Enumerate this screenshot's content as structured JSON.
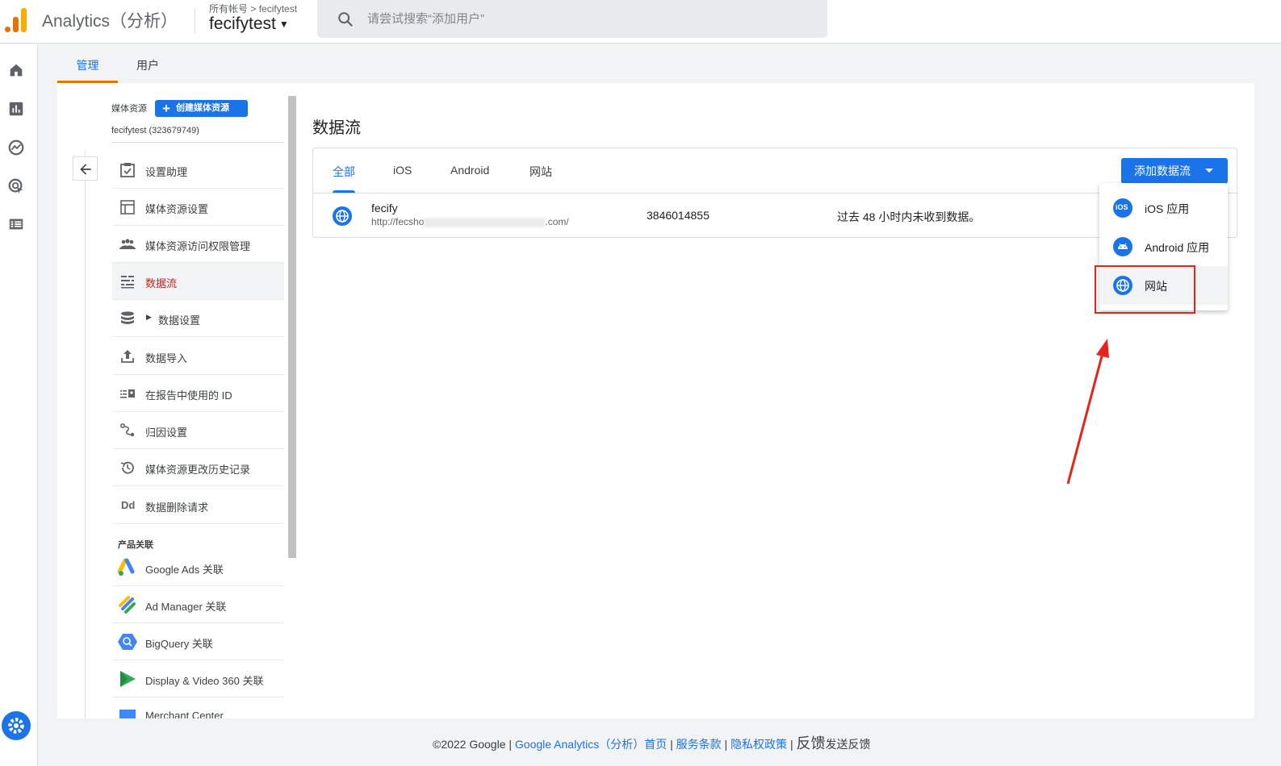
{
  "header": {
    "app_title": "Analytics（分析）",
    "breadcrumb_root": "所有帐号",
    "breadcrumb_sep": ">",
    "breadcrumb_account": "fecifytest",
    "account_name": "fecifytest",
    "search_placeholder": "请尝试搜索“添加用户”"
  },
  "rail": {
    "icons": [
      "home-icon",
      "reports-icon",
      "explore-icon",
      "advertising-icon",
      "configure-icon"
    ],
    "settings_icon": "gear-icon"
  },
  "admin_tabs": [
    {
      "label": "管理",
      "active": true
    },
    {
      "label": "用户",
      "active": false
    }
  ],
  "property": {
    "header_label": "媒体资源",
    "create_button": "创建媒体资源",
    "property_id": "fecifytest (323679749)",
    "nav_items": [
      {
        "label": "设置助理",
        "icon": "checklist-icon"
      },
      {
        "label": "媒体资源设置",
        "icon": "property-settings-icon"
      },
      {
        "label": "媒体资源访问权限管理",
        "icon": "people-icon"
      },
      {
        "label": "数据流",
        "icon": "data-streams-icon",
        "active": true
      },
      {
        "label": "数据设置",
        "icon": "database-icon",
        "expandable": true
      },
      {
        "label": "数据导入",
        "icon": "upload-icon"
      },
      {
        "label": "在报告中使用的 ID",
        "icon": "reporting-id-icon"
      },
      {
        "label": "归因设置",
        "icon": "attribution-icon"
      },
      {
        "label": "媒体资源更改历史记录",
        "icon": "history-icon"
      },
      {
        "label": "数据删除请求",
        "icon": "data-deletion-icon",
        "icon_text": "Dd"
      }
    ],
    "product_links_label": "产品关联",
    "product_links": [
      {
        "label": "Google Ads 关联",
        "icon": "google-ads-icon"
      },
      {
        "label": "Ad Manager 关联",
        "icon": "ad-manager-icon"
      },
      {
        "label": "BigQuery 关联",
        "icon": "bigquery-icon"
      },
      {
        "label": "Display & Video 360 关联",
        "icon": "dv360-icon"
      },
      {
        "label": "Merchant Center",
        "icon": "merchant-center-icon"
      }
    ]
  },
  "streams": {
    "title": "数据流",
    "tabs": [
      {
        "label": "全部",
        "active": true
      },
      {
        "label": "iOS",
        "active": false
      },
      {
        "label": "Android",
        "active": false
      },
      {
        "label": "网站",
        "active": false
      }
    ],
    "add_button": "添加数据流",
    "rows": [
      {
        "name": "fecify",
        "url_start": "http://fecsho",
        "url_end": ".com/",
        "stream_id": "3846014855",
        "status": "过去 48 小时内未收到数据。",
        "icon": "globe-icon"
      }
    ],
    "dropdown": [
      {
        "label": "iOS 应用",
        "icon": "ios-icon",
        "icon_text": "iOS"
      },
      {
        "label": "Android 应用",
        "icon": "android-icon"
      },
      {
        "label": "网站",
        "icon": "web-icon",
        "highlighted": true
      }
    ]
  },
  "footer": {
    "copyright": "©2022 Google |",
    "links": [
      "Google Analytics（分析）首页",
      "服务条款",
      "隐私权政策"
    ],
    "sep": "|",
    "feedback": "反馈",
    "send_feedback": "发送反馈"
  },
  "colors": {
    "accent": "#1a73e8",
    "active_tab_underline": "#e37400",
    "active_nav": "#c5221f",
    "annotation_red": "#e8231a"
  }
}
